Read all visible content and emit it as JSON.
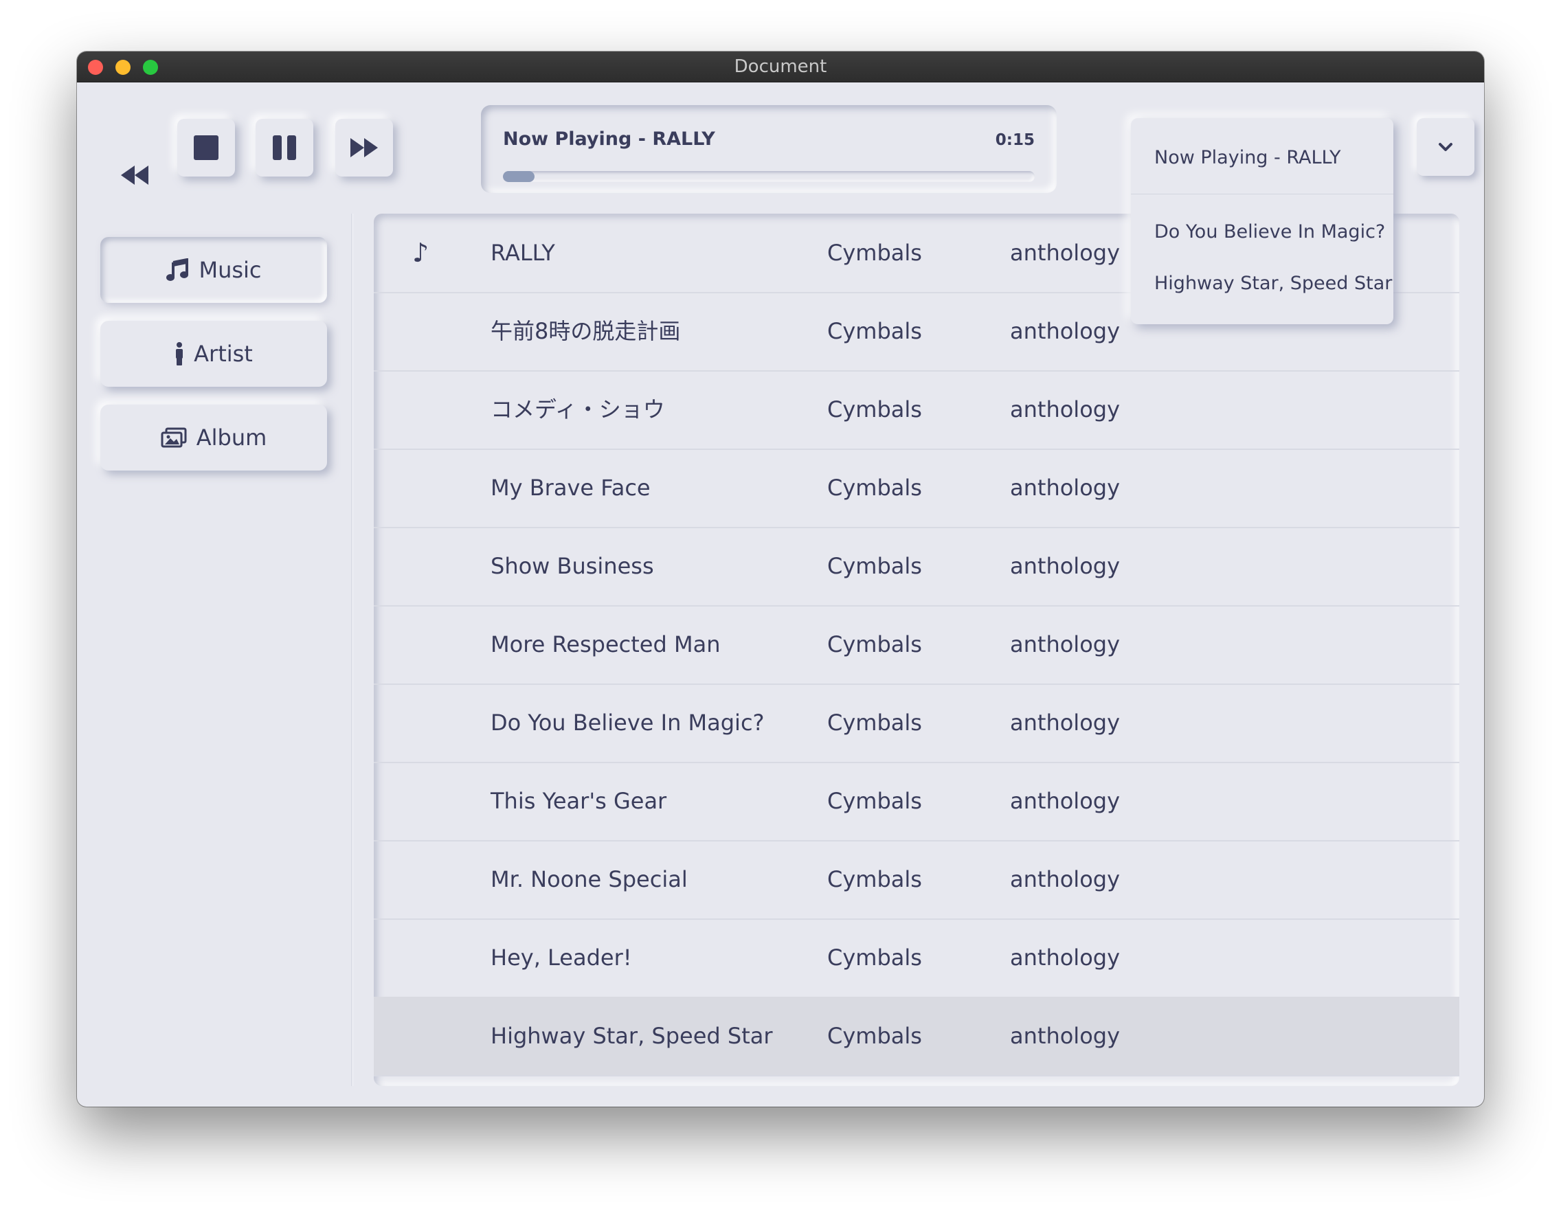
{
  "window": {
    "title": "Document"
  },
  "player": {
    "now_playing": "Now Playing - RALLY",
    "time": "0:15",
    "progress": 0.06,
    "buttons": {
      "rewind": "rewind-icon",
      "stop": "stop-icon",
      "pause": "pause-icon",
      "fast_forward": "fast-forward-icon"
    }
  },
  "dropdown": {
    "header": "Now Playing - RALLY",
    "items": [
      "Do You Believe In Magic?",
      "Highway Star, Speed Star"
    ],
    "toggle_icon": "chevron-down-icon"
  },
  "sidebar": {
    "items": [
      {
        "label": "Music",
        "icon": "music-note-icon"
      },
      {
        "label": "Artist",
        "icon": "person-icon"
      },
      {
        "label": "Album",
        "icon": "images-icon"
      }
    ]
  },
  "tracks": [
    {
      "playing_icon": "♪",
      "title": "RALLY",
      "artist": "Cymbals",
      "album": "anthology"
    },
    {
      "playing_icon": "",
      "title": "午前8時の脱走計画",
      "artist": "Cymbals",
      "album": "anthology"
    },
    {
      "playing_icon": "",
      "title": "コメディ・ショウ",
      "artist": "Cymbals",
      "album": "anthology"
    },
    {
      "playing_icon": "",
      "title": "My Brave Face",
      "artist": "Cymbals",
      "album": "anthology"
    },
    {
      "playing_icon": "",
      "title": "Show Business",
      "artist": "Cymbals",
      "album": "anthology"
    },
    {
      "playing_icon": "",
      "title": "More Respected Man",
      "artist": "Cymbals",
      "album": "anthology"
    },
    {
      "playing_icon": "",
      "title": "Do You Believe In Magic?",
      "artist": "Cymbals",
      "album": "anthology"
    },
    {
      "playing_icon": "",
      "title": "This Year's Gear",
      "artist": "Cymbals",
      "album": "anthology"
    },
    {
      "playing_icon": "",
      "title": "Mr. Noone Special",
      "artist": "Cymbals",
      "album": "anthology"
    },
    {
      "playing_icon": "",
      "title": "Hey, Leader!",
      "artist": "Cymbals",
      "album": "anthology"
    },
    {
      "playing_icon": "",
      "title": "Highway Star, Speed Star",
      "artist": "Cymbals",
      "album": "anthology"
    }
  ],
  "colors": {
    "background": "#e7e8ef",
    "text": "#3a3d5c",
    "progress": "#8d9bb8",
    "selected_row": "#d9dae1"
  }
}
